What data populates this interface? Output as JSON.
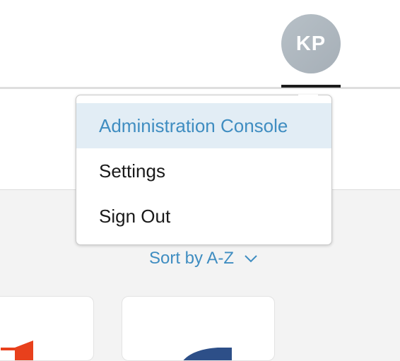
{
  "header": {
    "avatar_initials": "KP"
  },
  "user_menu": {
    "items": [
      {
        "label": "Administration Console",
        "active": true
      },
      {
        "label": "Settings",
        "active": false
      },
      {
        "label": "Sign Out",
        "active": false
      }
    ]
  },
  "sort": {
    "label": "Sort by A-Z",
    "icon": "chevron-down-icon"
  },
  "colors": {
    "accent": "#3f8dc1",
    "active_item_bg": "#e2edf5",
    "avatar_bg": "#aeb7bf",
    "red_logo": "#e8401c",
    "blue_logo": "#2d4f88"
  }
}
